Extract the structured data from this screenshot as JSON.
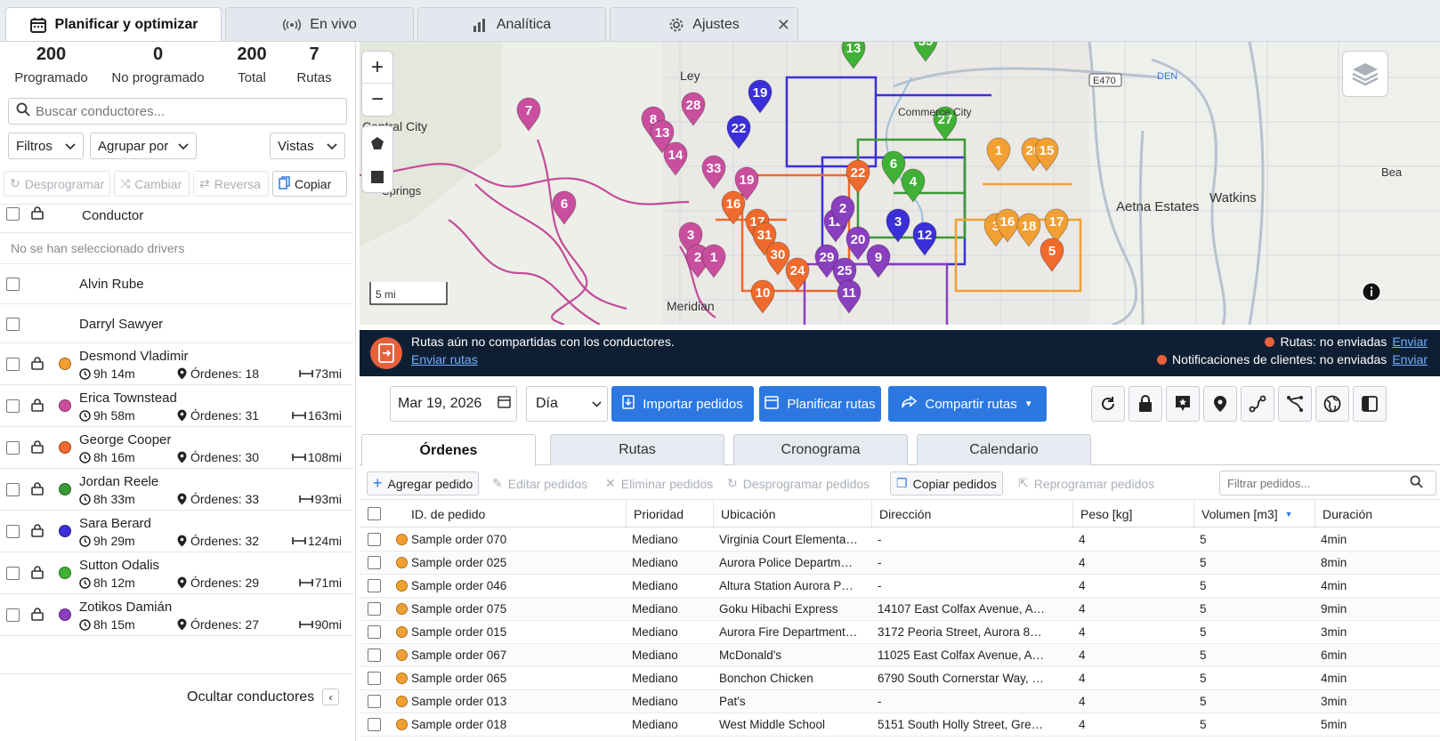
{
  "tabs": [
    {
      "label": "Planificar y optimizar",
      "icon": "calendar-icon"
    },
    {
      "label": "En vivo",
      "icon": "broadcast-icon"
    },
    {
      "label": "Analítica",
      "icon": "bar-chart-icon"
    },
    {
      "label": "Ajustes",
      "icon": "gear-icon"
    }
  ],
  "stats": [
    {
      "value": "200",
      "label": "Programado"
    },
    {
      "value": "0",
      "label": "No programado"
    },
    {
      "value": "200",
      "label": "Total"
    },
    {
      "value": "7",
      "label": "Rutas"
    }
  ],
  "search": {
    "placeholder": "Buscar conductores..."
  },
  "filters": {
    "filtros": "Filtros",
    "agrupar": "Agrupar por",
    "vistas": "Vistas"
  },
  "actions": {
    "desprogramar": "Desprogramar",
    "cambiar": "Cambiar",
    "reversa": "Reversa",
    "copiar": "Copiar"
  },
  "drivers_header": {
    "conductor": "Conductor",
    "empty": "No se han seleccionado drivers"
  },
  "unassigned_drivers": [
    "Alvin Rube",
    "Darryl Sawyer"
  ],
  "drivers": [
    {
      "name": "Desmond Vladimir",
      "time": "9h 14m",
      "orders": "Órdenes: 18",
      "dist": "73mi",
      "color": "#f2a033"
    },
    {
      "name": "Erica Townstead",
      "time": "9h 58m",
      "orders": "Órdenes: 31",
      "dist": "163mi",
      "color": "#c94f9e"
    },
    {
      "name": "George Cooper",
      "time": "8h 16m",
      "orders": "Órdenes: 30",
      "dist": "108mi",
      "color": "#ef6a2c"
    },
    {
      "name": "Jordan Reele",
      "time": "8h 33m",
      "orders": "Órdenes: 33",
      "dist": "93mi",
      "color": "#3a9a35"
    },
    {
      "name": "Sara Berard",
      "time": "9h 29m",
      "orders": "Órdenes: 32",
      "dist": "124mi",
      "color": "#3b2fd9"
    },
    {
      "name": "Sutton Odalis",
      "time": "8h 12m",
      "orders": "Órdenes: 29",
      "dist": "71mi",
      "color": "#41b036"
    },
    {
      "name": "Zotikos Damián",
      "time": "8h 15m",
      "orders": "Órdenes: 27",
      "dist": "90mi",
      "color": "#8a3fbf"
    }
  ],
  "hide_drivers": "Ocultar conductores",
  "map": {
    "places": [
      "Central City",
      "Springs",
      "Commerce City",
      "Aetna Estates",
      "Watkins",
      "DEN",
      "E470",
      "Meridian",
      "Bea",
      "Ley",
      "5 mi"
    ],
    "pins": [
      "7",
      "28",
      "8",
      "13",
      "14",
      "33",
      "19",
      "22",
      "6",
      "3",
      "2",
      "1",
      "16",
      "17",
      "31",
      "30",
      "24",
      "29",
      "25",
      "9",
      "12",
      "11",
      "20",
      "10",
      "27",
      "35",
      "13",
      "6",
      "4",
      "3",
      "1",
      "20",
      "15",
      "16",
      "18",
      "17",
      "5",
      "22",
      "2",
      "3",
      "12",
      "19"
    ]
  },
  "banner": {
    "message": "Rutas aún no compartidas con los conductores.",
    "link": "Enviar rutas",
    "routes_status": "Rutas: no enviadas",
    "notif_status": "Notificaciones de clientes: no enviadas",
    "send": "Enviar"
  },
  "toolbar": {
    "date": "Mar 19, 2026",
    "period": "Día",
    "import": "Importar pedidos",
    "plan": "Planificar rutas",
    "share": "Compartir rutas"
  },
  "bottom_tabs": [
    "Órdenes",
    "Rutas",
    "Cronograma",
    "Calendario"
  ],
  "order_actions": {
    "add": "Agregar pedido",
    "edit": "Editar pedidos",
    "delete": "Eliminar pedidos",
    "unschedule": "Desprogramar pedidos",
    "copy": "Copiar pedidos",
    "reschedule": "Reprogramar pedidos",
    "filter_placeholder": "Filtrar pedidos..."
  },
  "table": {
    "columns": [
      "ID. de pedido",
      "Prioridad",
      "Ubicación",
      "Dirección",
      "Peso [kg]",
      "Volumen [m3]",
      "Duración"
    ],
    "rows": [
      [
        "Sample order 070",
        "Mediano",
        "Virginia Court Elementa…",
        "-",
        "4",
        "5",
        "4min"
      ],
      [
        "Sample order 025",
        "Mediano",
        "Aurora Police Departm…",
        "-",
        "4",
        "5",
        "8min"
      ],
      [
        "Sample order 046",
        "Mediano",
        "Altura Station Aurora P…",
        "-",
        "4",
        "5",
        "4min"
      ],
      [
        "Sample order 075",
        "Mediano",
        "Goku Hibachi Express",
        "14107 East Colfax Avenue, A…",
        "4",
        "5",
        "9min"
      ],
      [
        "Sample order 015",
        "Mediano",
        "Aurora Fire Department…",
        "3172 Peoria Street, Aurora 8…",
        "4",
        "5",
        "3min"
      ],
      [
        "Sample order 067",
        "Mediano",
        "McDonald's",
        "11025 East Colfax Avenue, A…",
        "4",
        "5",
        "6min"
      ],
      [
        "Sample order 065",
        "Mediano",
        "Bonchon Chicken",
        "6790 South Cornerstar Way, …",
        "4",
        "5",
        "4min"
      ],
      [
        "Sample order 013",
        "Mediano",
        "Pat's",
        "-",
        "4",
        "5",
        "3min"
      ],
      [
        "Sample order 018",
        "Mediano",
        "West Middle School",
        "5151 South Holly Street, Gre…",
        "4",
        "5",
        "5min"
      ]
    ]
  }
}
